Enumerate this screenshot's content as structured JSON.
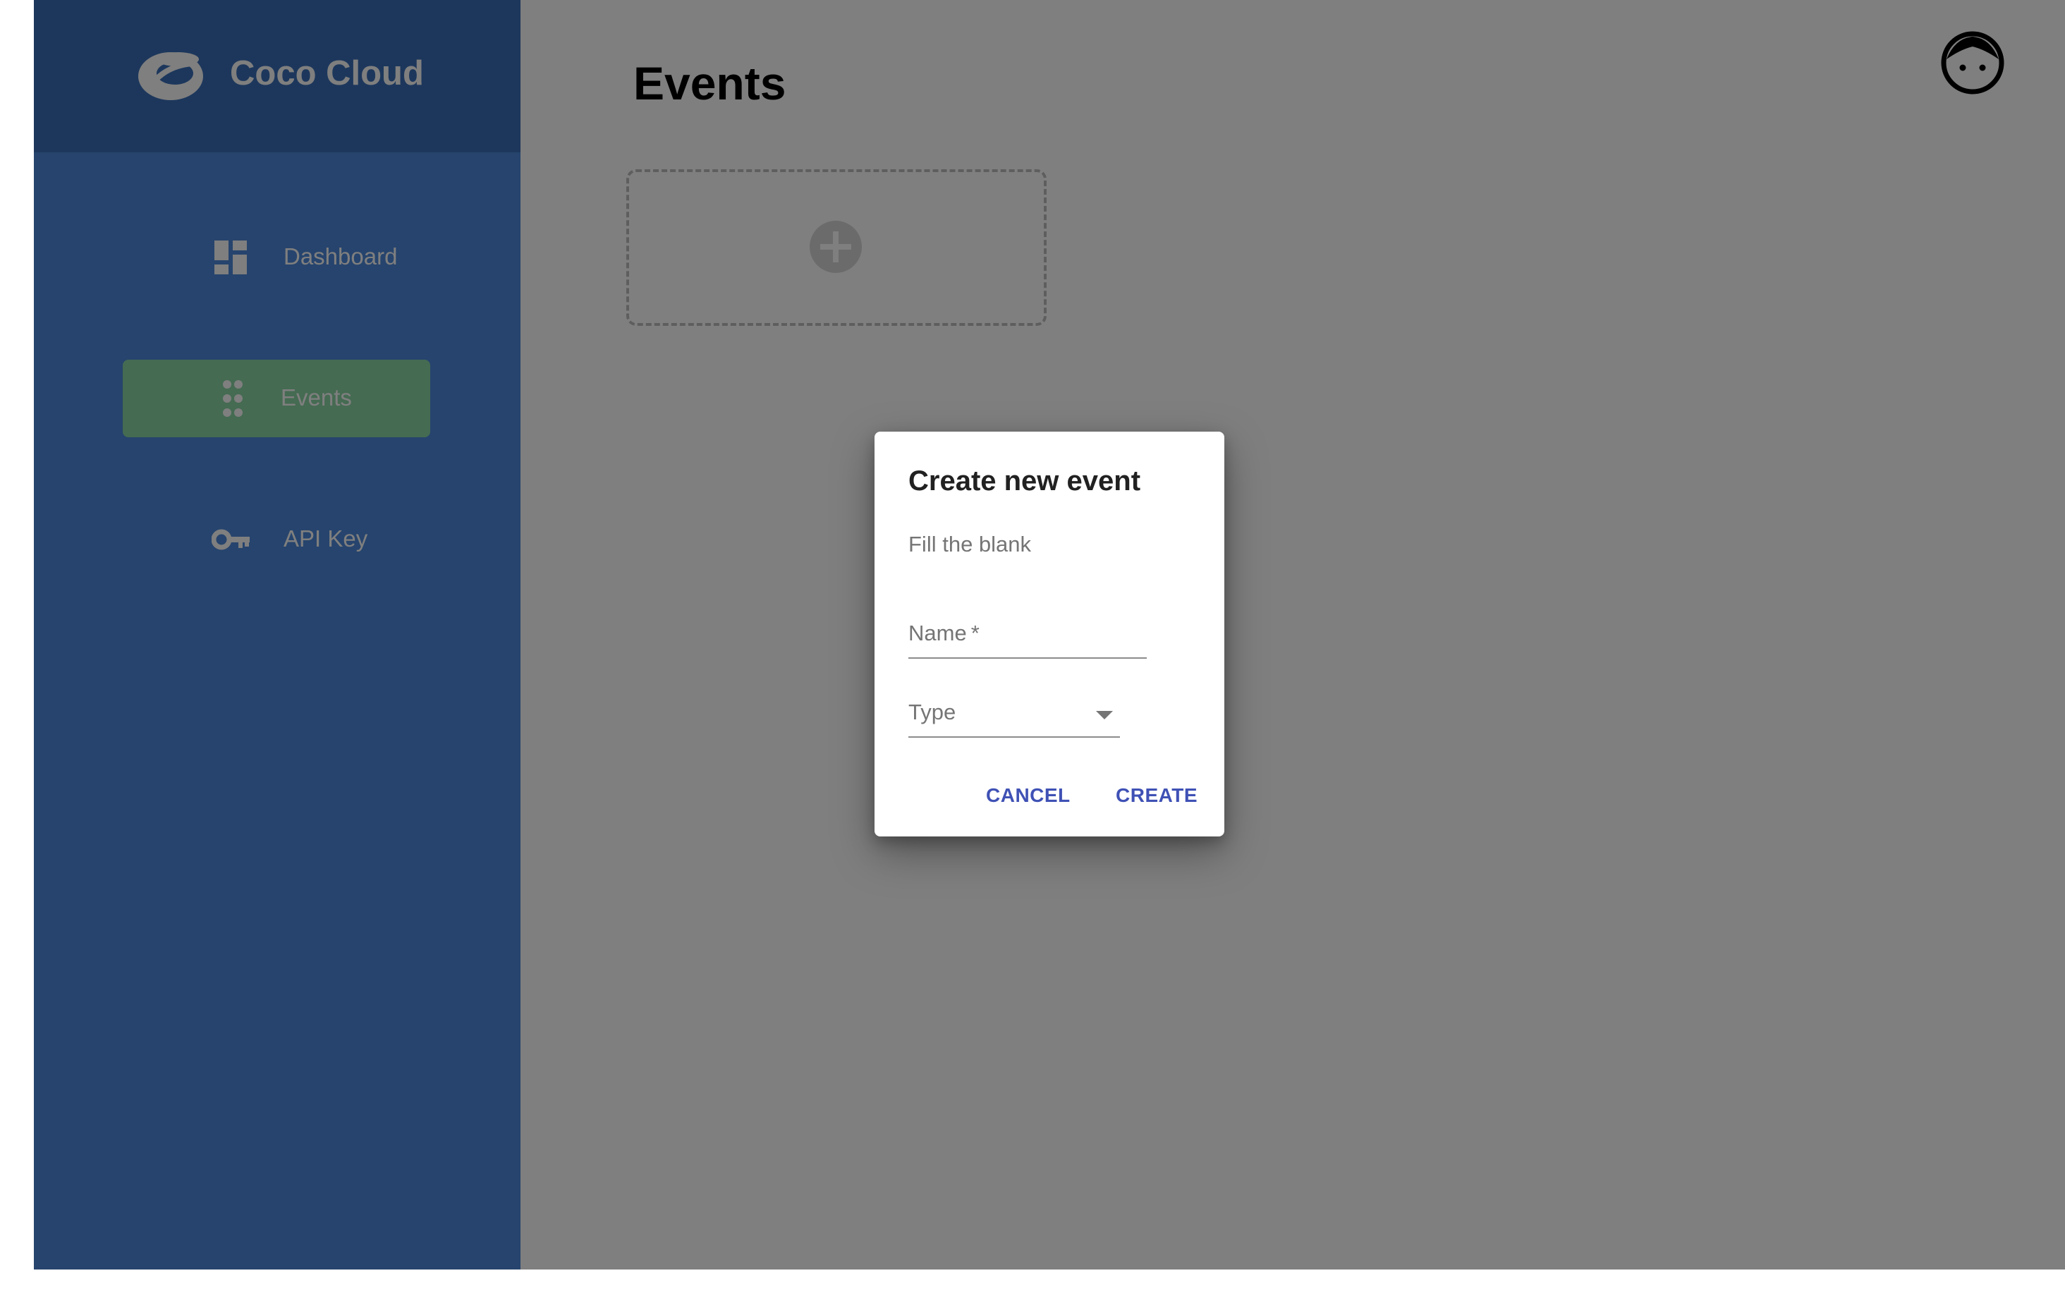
{
  "brand": {
    "name": "Coco Cloud",
    "logo_icon": "coco-cloud-logo-icon"
  },
  "sidebar": {
    "items": [
      {
        "label": "Dashboard",
        "icon": "dashboard-icon",
        "active": false
      },
      {
        "label": "Events",
        "icon": "events-grid-icon",
        "active": true
      },
      {
        "label": "API Key",
        "icon": "key-icon",
        "active": false
      }
    ]
  },
  "main": {
    "title": "Events",
    "add_card_icon": "plus-circle-icon",
    "avatar_icon": "user-avatar-face-icon"
  },
  "dialog": {
    "title": "Create new event",
    "subtitle": "Fill the blank",
    "name_label": "Name",
    "name_required_mark": "*",
    "type_label": "Type",
    "cancel_label": "CANCEL",
    "create_label": "CREATE"
  },
  "colors": {
    "sidebar": "#4d89da",
    "sidebar_header": "#3a6fb8",
    "active_item": "#8bd6a4",
    "button_text": "#3f51b5"
  }
}
